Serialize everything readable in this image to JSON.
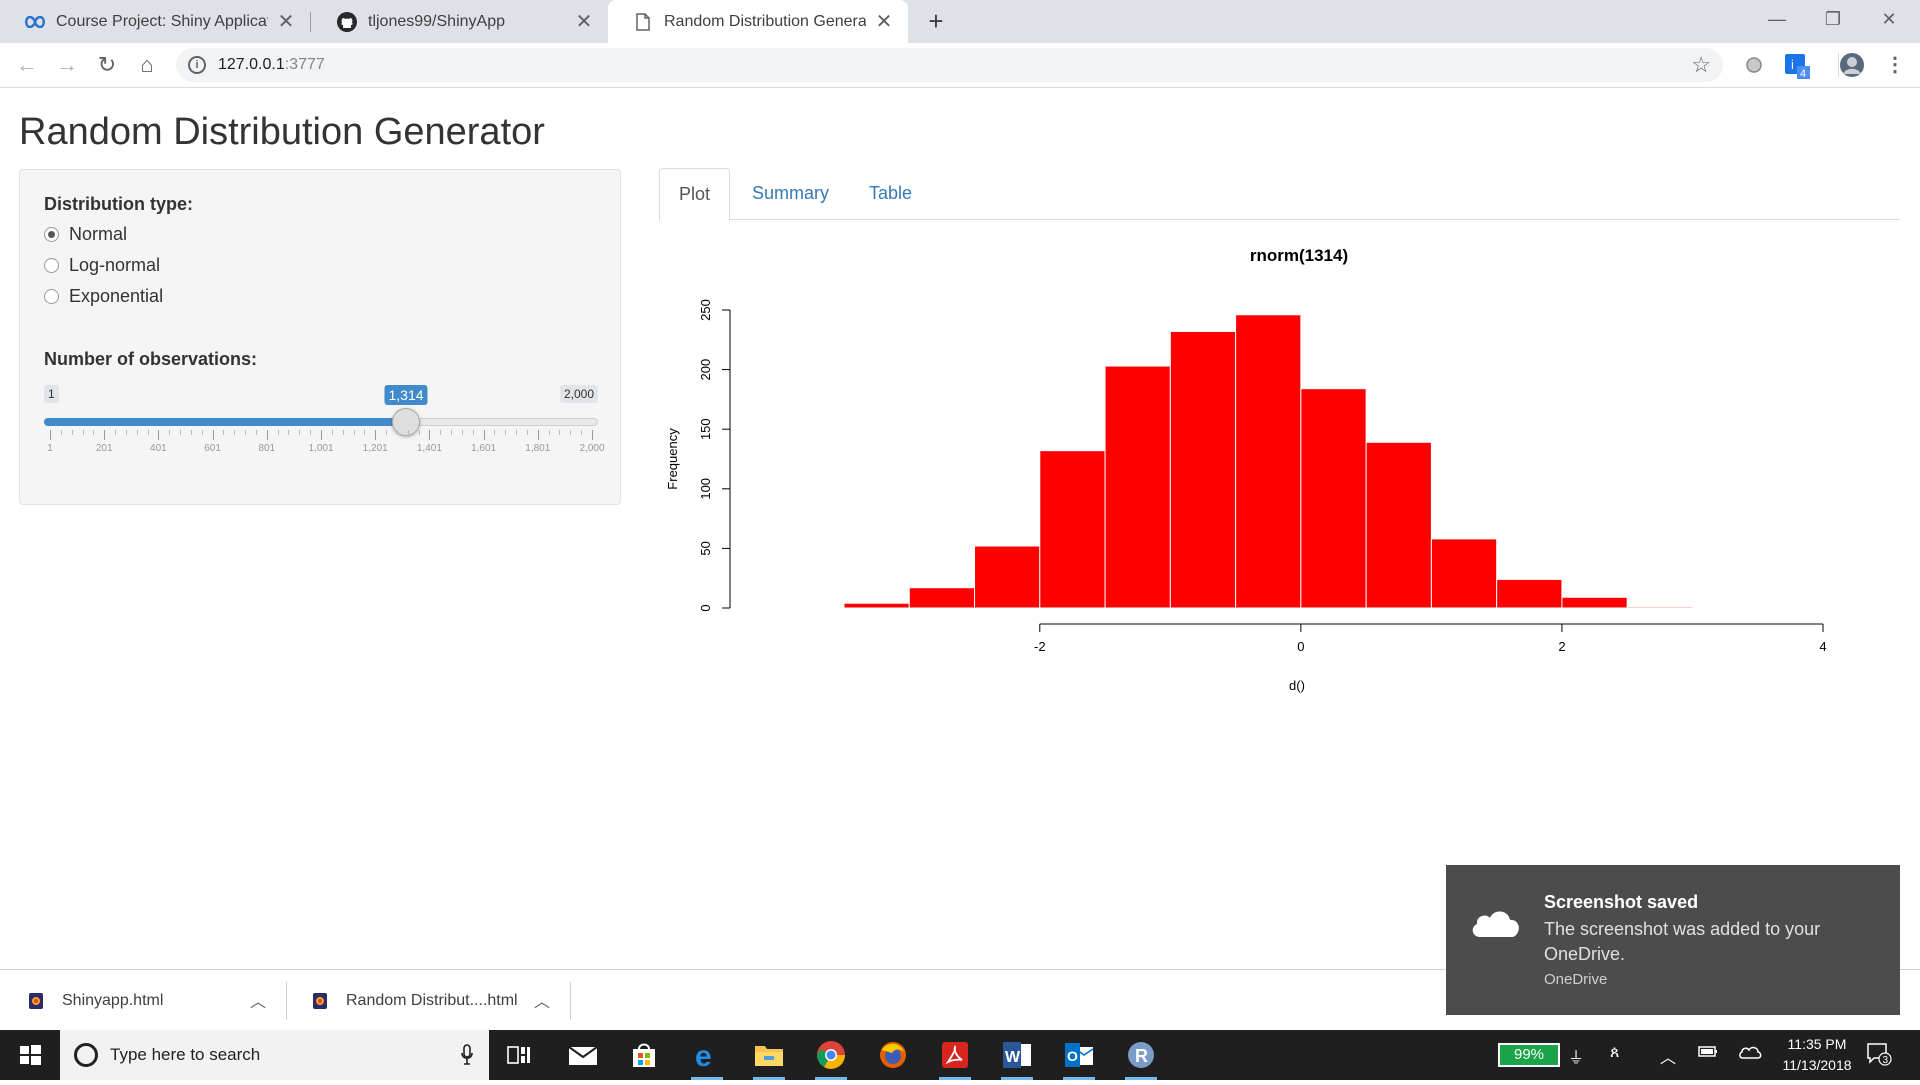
{
  "browser": {
    "tabs": [
      {
        "title": "Course Project: Shiny Application",
        "icon": "coursera-infinity-icon"
      },
      {
        "title": "tljones99/ShinyApp",
        "icon": "github-icon"
      },
      {
        "title": "Random Distribution Generator",
        "icon": "page-icon"
      }
    ],
    "url_host": "127.0.0.1",
    "url_port": ":3777",
    "extension_badge": "4"
  },
  "app": {
    "title": "Random Distribution Generator",
    "distribution": {
      "label": "Distribution type:",
      "options": [
        "Normal",
        "Log-normal",
        "Exponential"
      ],
      "selected": "Normal"
    },
    "observations": {
      "label": "Number of observations:",
      "min": 1,
      "max": 2000,
      "value": 1314,
      "min_label": "1",
      "max_label": "2,000",
      "value_label": "1,314",
      "tick_labels": [
        "1",
        "201",
        "401",
        "601",
        "801",
        "1,001",
        "1,201",
        "1,401",
        "1,601",
        "1,801",
        "2,000"
      ]
    },
    "tabs": [
      "Plot",
      "Summary",
      "Table"
    ],
    "active_tab": "Plot"
  },
  "chart_data": {
    "type": "bar",
    "title": "rnorm(1314)",
    "xlabel": "d()",
    "ylabel": "Frequency",
    "bar_color": "#ff0000",
    "bins": [
      -3.5,
      -3,
      -2.5,
      -2,
      -1.5,
      -1,
      -0.5,
      0,
      0.5,
      1,
      1.5,
      2,
      2.5,
      3,
      3.5
    ],
    "values": [
      4,
      17,
      52,
      132,
      203,
      232,
      246,
      184,
      139,
      58,
      24,
      9,
      1
    ],
    "ylim": [
      0,
      250
    ],
    "yticks": [
      0,
      50,
      100,
      150,
      200,
      250
    ],
    "xlim": [
      -3.5,
      4
    ],
    "xticks": [
      -2,
      0,
      2,
      4
    ]
  },
  "downloads": [
    {
      "name": "Shinyapp.html"
    },
    {
      "name": "Random Distribut....html"
    }
  ],
  "toast": {
    "title": "Screenshot saved",
    "body": "The screenshot was added to your OneDrive.",
    "app": "OneDrive"
  },
  "taskbar": {
    "search_placeholder": "Type here to search",
    "battery": "99%",
    "time": "11:35 PM",
    "date": "11/13/2018",
    "notifications": "3",
    "apps": [
      "task-view",
      "mail",
      "store",
      "edge",
      "file-explorer",
      "chrome",
      "firefox",
      "acrobat",
      "word",
      "outlook",
      "r"
    ]
  }
}
